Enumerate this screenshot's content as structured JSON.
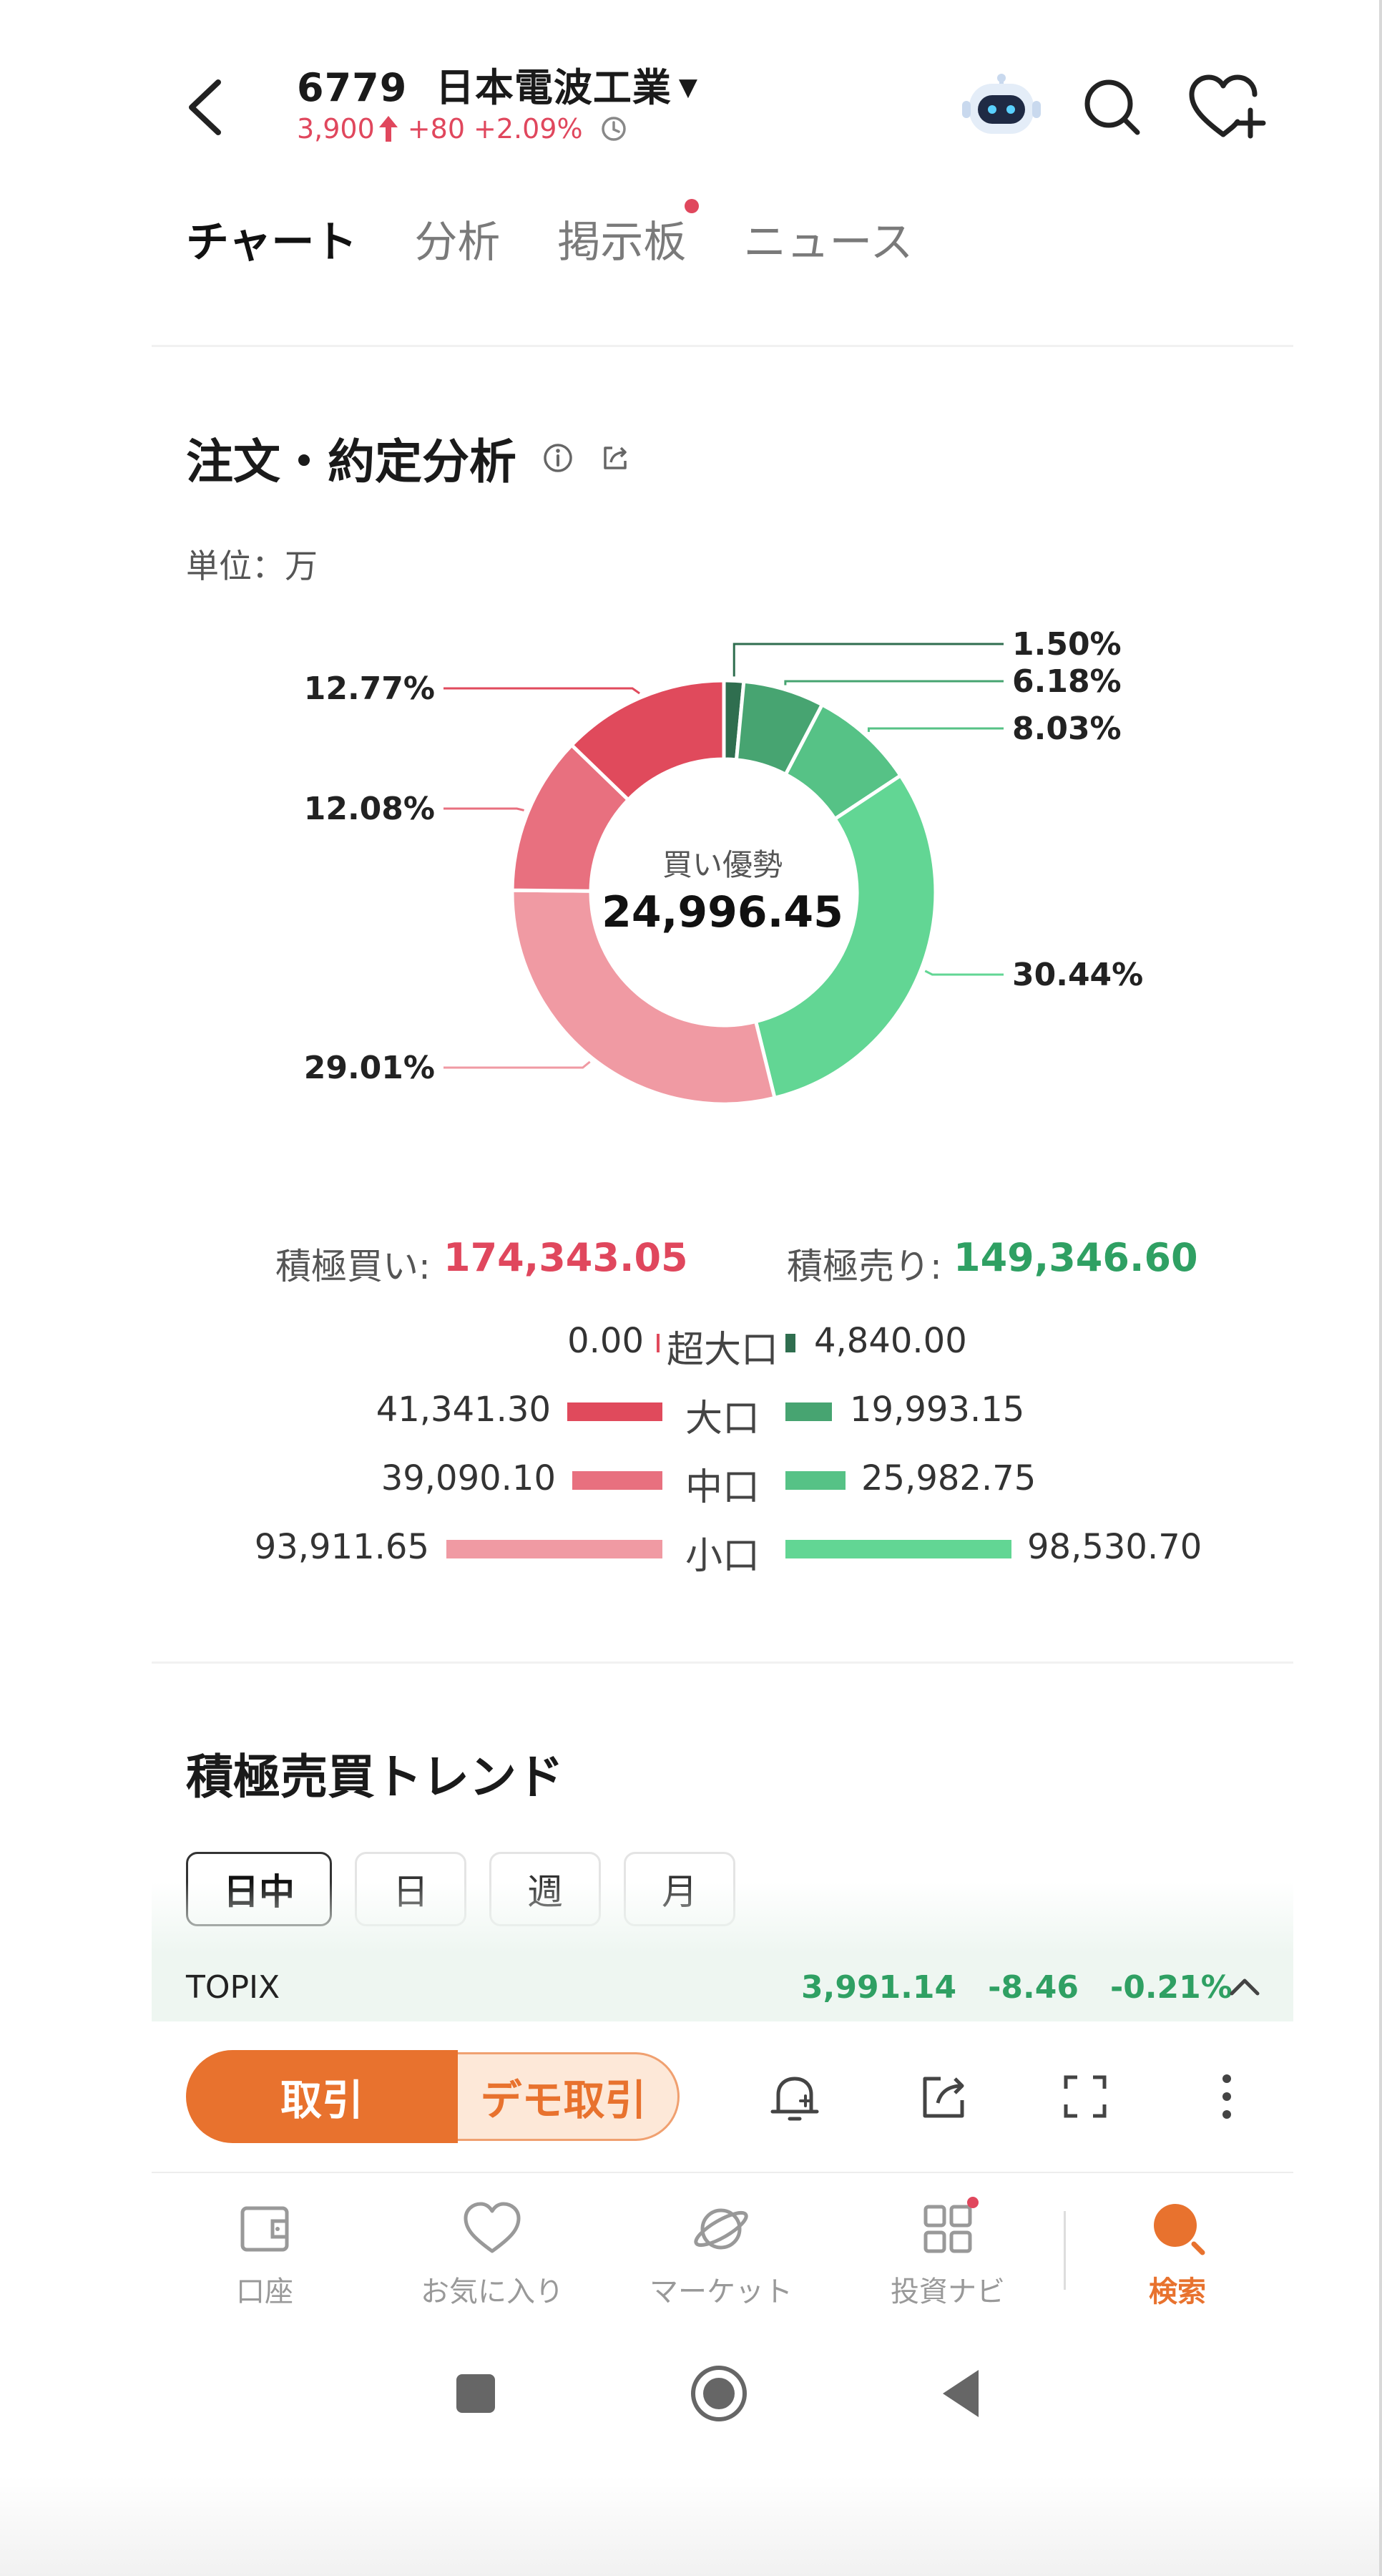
{
  "header": {
    "code": "6779",
    "name": "日本電波工業",
    "price": "3,900",
    "change": "+80",
    "change_pct": "+2.09%"
  },
  "tabs": [
    {
      "label": "チャート",
      "active": true
    },
    {
      "label": "分析",
      "active": false
    },
    {
      "label": "掲示板",
      "active": false,
      "badge": true
    },
    {
      "label": "ニュース",
      "active": false
    }
  ],
  "order_analysis": {
    "title": "注文・約定分析",
    "unit": "単位：万",
    "center_label": "買い優勢",
    "center_value": "24,996.45",
    "buy_label": "積極買い:",
    "buy_value": "174,343.05",
    "sell_label": "積極売り:",
    "sell_value": "149,346.60",
    "rows": [
      {
        "cat": "超大口",
        "buy": "0.00",
        "sell": "4,840.00"
      },
      {
        "cat": "大口",
        "buy": "41,341.30",
        "sell": "19,993.15"
      },
      {
        "cat": "中口",
        "buy": "39,090.10",
        "sell": "25,982.75"
      },
      {
        "cat": "小口",
        "buy": "93,911.65",
        "sell": "98,530.70"
      }
    ]
  },
  "chart_data": {
    "type": "pie",
    "title": "",
    "categories": [
      "超大口(売り)",
      "大口(売り)",
      "中口(売り)",
      "小口(売り)",
      "小口(買い)",
      "中口(買い)",
      "大口(買い)"
    ],
    "values": [
      1.5,
      6.18,
      8.03,
      30.44,
      29.01,
      12.08,
      12.77
    ],
    "labels": [
      "1.50%",
      "6.18%",
      "8.03%",
      "30.44%",
      "29.01%",
      "12.08%",
      "12.77%"
    ],
    "colors": [
      "#2f6e4f",
      "#47a471",
      "#56c286",
      "#62d694",
      "#f09aa3",
      "#e8707f",
      "#e04a5c"
    ]
  },
  "trend": {
    "title": "積極売買トレンド",
    "periods": [
      {
        "label": "日中",
        "active": true
      },
      {
        "label": "日",
        "active": false
      },
      {
        "label": "週",
        "active": false
      },
      {
        "label": "月",
        "active": false
      }
    ]
  },
  "index_bar": {
    "name": "TOPIX",
    "value": "3,991.14",
    "change": "-8.46",
    "change_pct": "-0.21%"
  },
  "actions": {
    "trade": "取引",
    "demo": "デモ取引"
  },
  "bottom_nav": [
    {
      "label": "口座",
      "icon": "wallet-icon",
      "active": false
    },
    {
      "label": "お気に入り",
      "icon": "heart-icon",
      "active": false
    },
    {
      "label": "マーケット",
      "icon": "planet-icon",
      "active": false
    },
    {
      "label": "投資ナビ",
      "icon": "grid-icon",
      "active": false,
      "badge": true
    },
    {
      "label": "検索",
      "icon": "search-icon",
      "active": true
    }
  ],
  "colors": {
    "accent": "#e8722e",
    "up": "#e0475d",
    "down": "#2fa063"
  }
}
